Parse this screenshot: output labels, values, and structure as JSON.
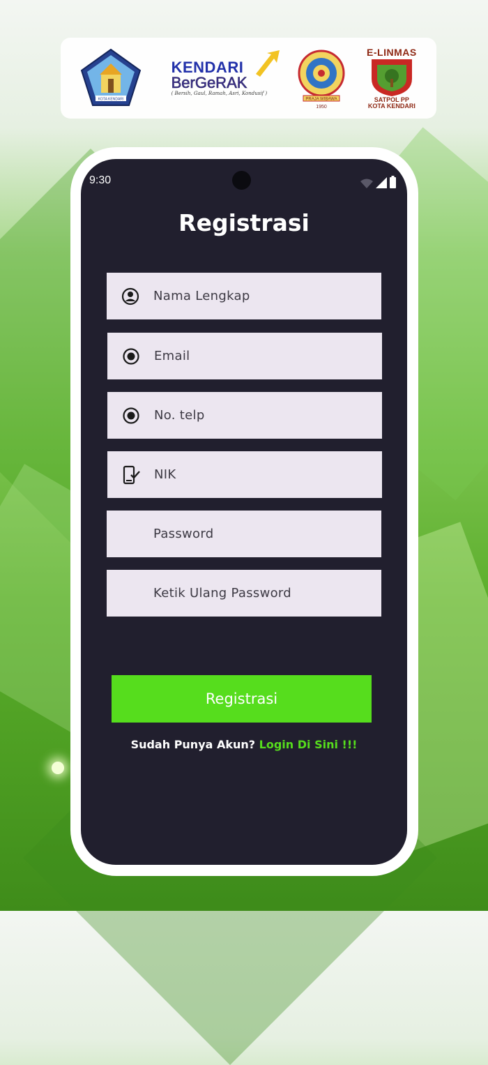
{
  "logos": {
    "kota_kendari": {
      "name": "kota-kendari-emblem",
      "caption": "KOTA KENDARI"
    },
    "kendari_bergerak": {
      "line1": "KENDARI",
      "line2": "BerGeRAK",
      "tagline": "( Bersih, Gaul, Ramah, Asri, Kondusif )"
    },
    "polisi_pamong_praja": {
      "name": "polisi-pamong-praja-emblem",
      "text": "PRAJA WIBAWA",
      "year": "1950"
    },
    "elinmas": {
      "top": "E-LINMAS",
      "line1": "SATPOL PP",
      "line2": "KOTA KENDARI"
    }
  },
  "status_bar": {
    "time": "9:30"
  },
  "page": {
    "title": "Registrasi"
  },
  "form": {
    "full_name": {
      "placeholder": "Nama Lengkap",
      "icon": "account-circle-icon"
    },
    "email": {
      "placeholder": "Email",
      "icon": "radio-button-icon"
    },
    "phone": {
      "placeholder": "No. telp",
      "icon": "radio-button-icon"
    },
    "nik": {
      "placeholder": "NIK",
      "icon": "phone-check-icon"
    },
    "password": {
      "placeholder": "Password"
    },
    "confirm_password": {
      "placeholder": "Ketik Ulang Password"
    }
  },
  "actions": {
    "register_label": "Registrasi",
    "have_account_text": "Sudah Punya Akun?",
    "login_link": "Login Di Sini !!!"
  },
  "colors": {
    "accent": "#56dd1d",
    "screen": "#211f2e",
    "field": "#ece6f0"
  }
}
